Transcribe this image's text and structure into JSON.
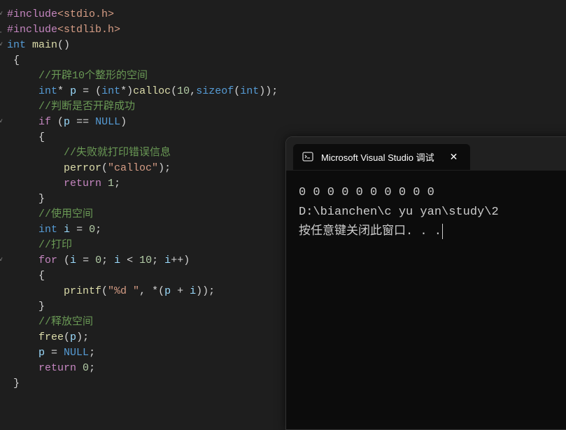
{
  "code": {
    "l1_macro": "#include",
    "l1_inc": "<stdio.h>",
    "l2_macro": "#include",
    "l2_inc": "<stdlib.h>",
    "l3_kw_int": "int",
    "l3_func_main": "main",
    "l3_par": "()",
    "l4_brace": "{",
    "l5_cmt": "//开辟10个整形的空间",
    "l6_kw_int": "int",
    "l6_star": "*",
    "l6_var_p": "p",
    "l6_eq": " = (",
    "l6_kw_int2": "int",
    "l6_cast": "*)",
    "l6_func": "calloc",
    "l6_open": "(",
    "l6_n1": "10",
    "l6_comma": ",",
    "l6_sizeof": "sizeof",
    "l6_open2": "(",
    "l6_kw_int3": "int",
    "l6_close": "));",
    "l7_cmt": "//判断是否开辟成功",
    "l8_if": "if",
    "l8_open": " (",
    "l8_var_p": "p",
    "l8_eqeq": " == ",
    "l8_null": "NULL",
    "l8_close": ")",
    "l9_brace": "{",
    "l10_cmt": "//失败就打印错误信息",
    "l11_func": "perror",
    "l11_open": "(",
    "l11_str": "\"calloc\"",
    "l11_close": ");",
    "l12_ret": "return",
    "l12_n": "1",
    "l12_semi": ";",
    "l13_brace": "}",
    "l14_cmt": "//使用空间",
    "l15_kw_int": "int",
    "l15_var_i": "i",
    "l15_eq": " = ",
    "l15_n": "0",
    "l15_semi": ";",
    "l16_cmt": "//打印",
    "l17_for": "for",
    "l17_open": " (",
    "l17_var_i": "i",
    "l17_eq": " = ",
    "l17_n0": "0",
    "l17_semi1": "; ",
    "l17_var_i2": "i",
    "l17_lt": " < ",
    "l17_n10": "10",
    "l17_semi2": "; ",
    "l17_var_i3": "i",
    "l17_pp": "++)",
    "l18_brace": "{",
    "l19_func": "printf",
    "l19_open": "(",
    "l19_str": "\"%d \"",
    "l19_comma": ", *(",
    "l19_var_p": "p",
    "l19_plus": " + ",
    "l19_var_i": "i",
    "l19_close": "));",
    "l20_brace": "}",
    "l21_cmt": "//释放空间",
    "l22_func": "free",
    "l22_open": "(",
    "l22_var_p": "p",
    "l22_close": ");",
    "l23_var_p": "p",
    "l23_eq": " = ",
    "l23_null": "NULL",
    "l23_semi": ";",
    "l24_ret": "return",
    "l24_n": "0",
    "l24_semi": ";",
    "l25_brace": "}"
  },
  "console": {
    "tab_title": "Microsoft Visual Studio 调试",
    "output_line1": "0 0 0 0 0 0 0 0 0 0",
    "output_line2": "D:\\bianchen\\c yu yan\\study\\2",
    "output_line3": "按任意键关闭此窗口. . ."
  }
}
